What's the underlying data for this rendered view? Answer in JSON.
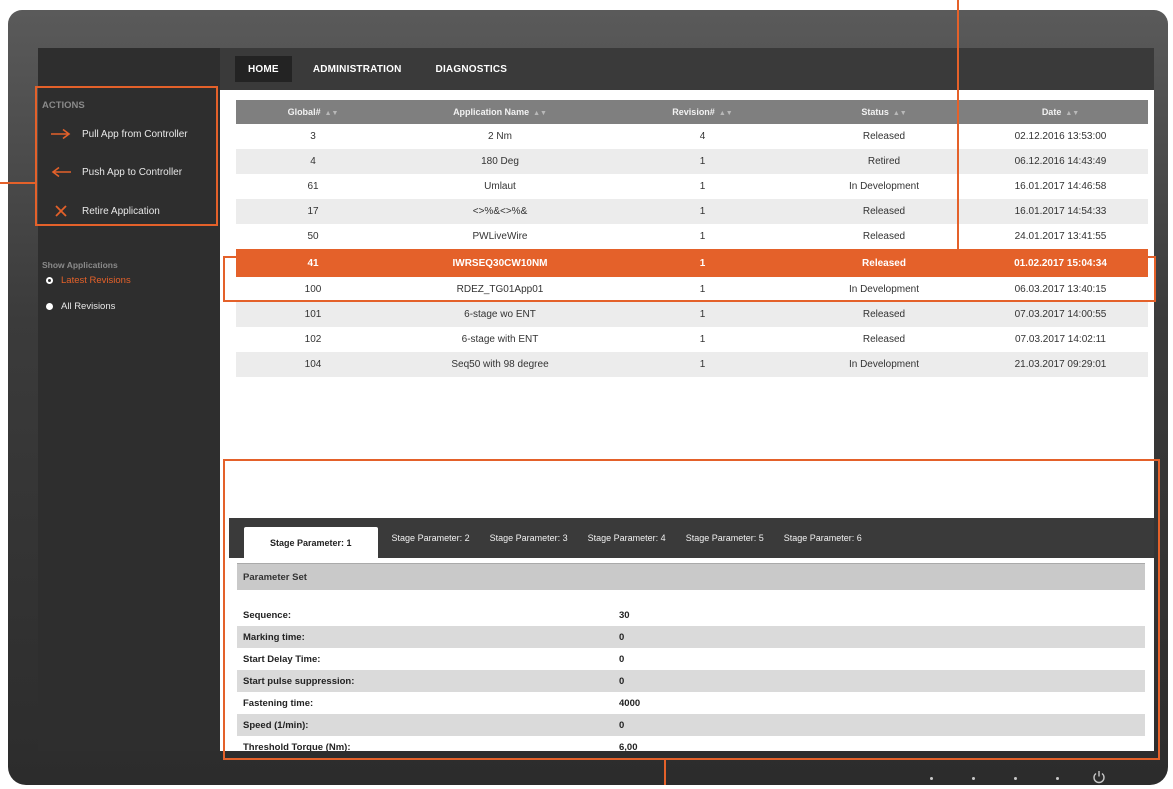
{
  "nav": {
    "tabs": [
      {
        "label": "HOME",
        "active": true
      },
      {
        "label": "ADMINISTRATION",
        "active": false
      },
      {
        "label": "DIAGNOSTICS",
        "active": false
      }
    ]
  },
  "sidebar": {
    "actions_title": "ACTIONS",
    "actions": [
      {
        "label": "Pull App from Controller",
        "icon": "arrow-right-icon"
      },
      {
        "label": "Push App to Controller",
        "icon": "arrow-left-icon"
      },
      {
        "label": "Retire Application",
        "icon": "close-x-icon"
      }
    ],
    "show_title": "Show Applications",
    "options": [
      {
        "label": "Latest Revisions",
        "selected": true
      },
      {
        "label": "All Revisions",
        "selected": false
      }
    ]
  },
  "table": {
    "columns": [
      "Global#",
      "Application Name",
      "Revision#",
      "Status",
      "Date"
    ],
    "rows": [
      {
        "global": "3",
        "name": "2 Nm",
        "revision": "4",
        "status": "Released",
        "date": "02.12.2016 13:53:00"
      },
      {
        "global": "4",
        "name": "180 Deg",
        "revision": "1",
        "status": "Retired",
        "date": "06.12.2016 14:43:49"
      },
      {
        "global": "61",
        "name": "Umlaut",
        "revision": "1",
        "status": "In Development",
        "date": "16.01.2017 14:46:58"
      },
      {
        "global": "17",
        "name": "<>%&<>%&",
        "revision": "1",
        "status": "Released",
        "date": "16.01.2017 14:54:33"
      },
      {
        "global": "50",
        "name": "PWLiveWire",
        "revision": "1",
        "status": "Released",
        "date": "24.01.2017 13:41:55"
      },
      {
        "global": "41",
        "name": "IWRSEQ30CW10NM",
        "revision": "1",
        "status": "Released",
        "date": "01.02.2017 15:04:34"
      },
      {
        "global": "100",
        "name": "RDEZ_TG01App01",
        "revision": "1",
        "status": "In Development",
        "date": "06.03.2017 13:40:15"
      },
      {
        "global": "101",
        "name": "6-stage wo ENT",
        "revision": "1",
        "status": "Released",
        "date": "07.03.2017 14:00:55"
      },
      {
        "global": "102",
        "name": "6-stage with ENT",
        "revision": "1",
        "status": "Released",
        "date": "07.03.2017 14:02:11"
      },
      {
        "global": "104",
        "name": "Seq50 with 98 degree",
        "revision": "1",
        "status": "In Development",
        "date": "21.03.2017 09:29:01"
      }
    ],
    "selected_index": 5
  },
  "stage_tabs": [
    "Stage Parameter: 1",
    "Stage Parameter: 2",
    "Stage Parameter: 3",
    "Stage Parameter: 4",
    "Stage Parameter: 5",
    "Stage Parameter: 6"
  ],
  "parameters": {
    "title": "Parameter Set",
    "rows": [
      {
        "label": "Sequence:",
        "value": "30"
      },
      {
        "label": "Marking time:",
        "value": "0"
      },
      {
        "label": "Start Delay Time:",
        "value": "0"
      },
      {
        "label": "Start pulse suppression:",
        "value": "0"
      },
      {
        "label": "Fastening time:",
        "value": "4000"
      },
      {
        "label": "Speed (1/min):",
        "value": "0"
      },
      {
        "label": "Threshold Torque (Nm):",
        "value": "6,00"
      }
    ]
  },
  "colors": {
    "accent": "#e4612a",
    "sidebar_bg": "#2e2e2e",
    "header_bg": "#7f7f7f"
  }
}
